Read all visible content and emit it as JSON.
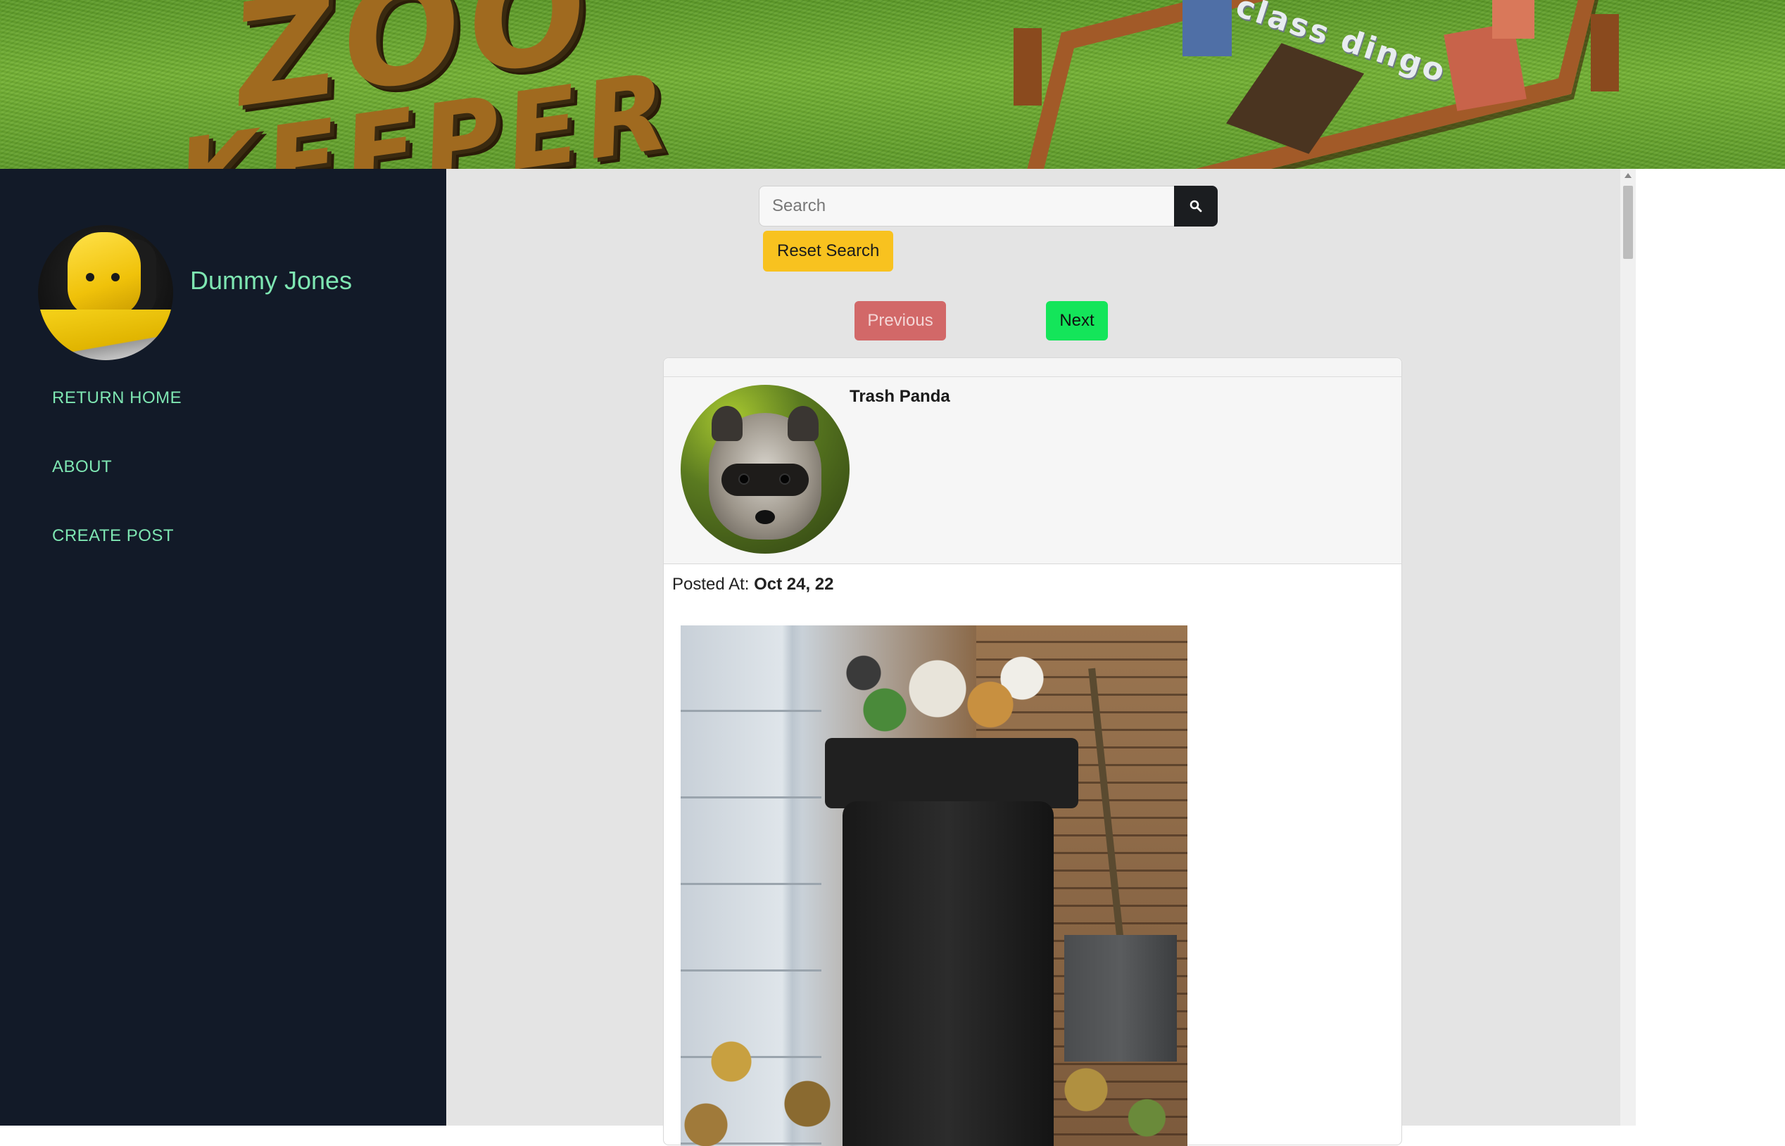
{
  "banner": {
    "text_top": "ZOO",
    "text_bottom": "KEEPER",
    "label": "class dingo"
  },
  "sidebar": {
    "profile_name": "Dummy Jones",
    "nav": [
      {
        "label": "RETURN HOME"
      },
      {
        "label": "ABOUT"
      },
      {
        "label": "CREATE POST"
      }
    ]
  },
  "search": {
    "placeholder": "Search",
    "value": "",
    "reset_label": "Reset Search"
  },
  "pagination": {
    "previous_label": "Previous",
    "next_label": "Next"
  },
  "post": {
    "author": "Trash Panda",
    "posted_label": "Posted At:",
    "posted_date": "Oct 24, 22"
  },
  "colors": {
    "sidebar_bg": "#121a28",
    "nav_text": "#7ee6b2",
    "main_bg": "#e4e4e4",
    "reset_button": "#f8c21f",
    "previous_button": "#d26868",
    "next_button": "#14e55a",
    "search_button": "#1b1d20"
  },
  "icons": {
    "search_button": "search-icon"
  }
}
